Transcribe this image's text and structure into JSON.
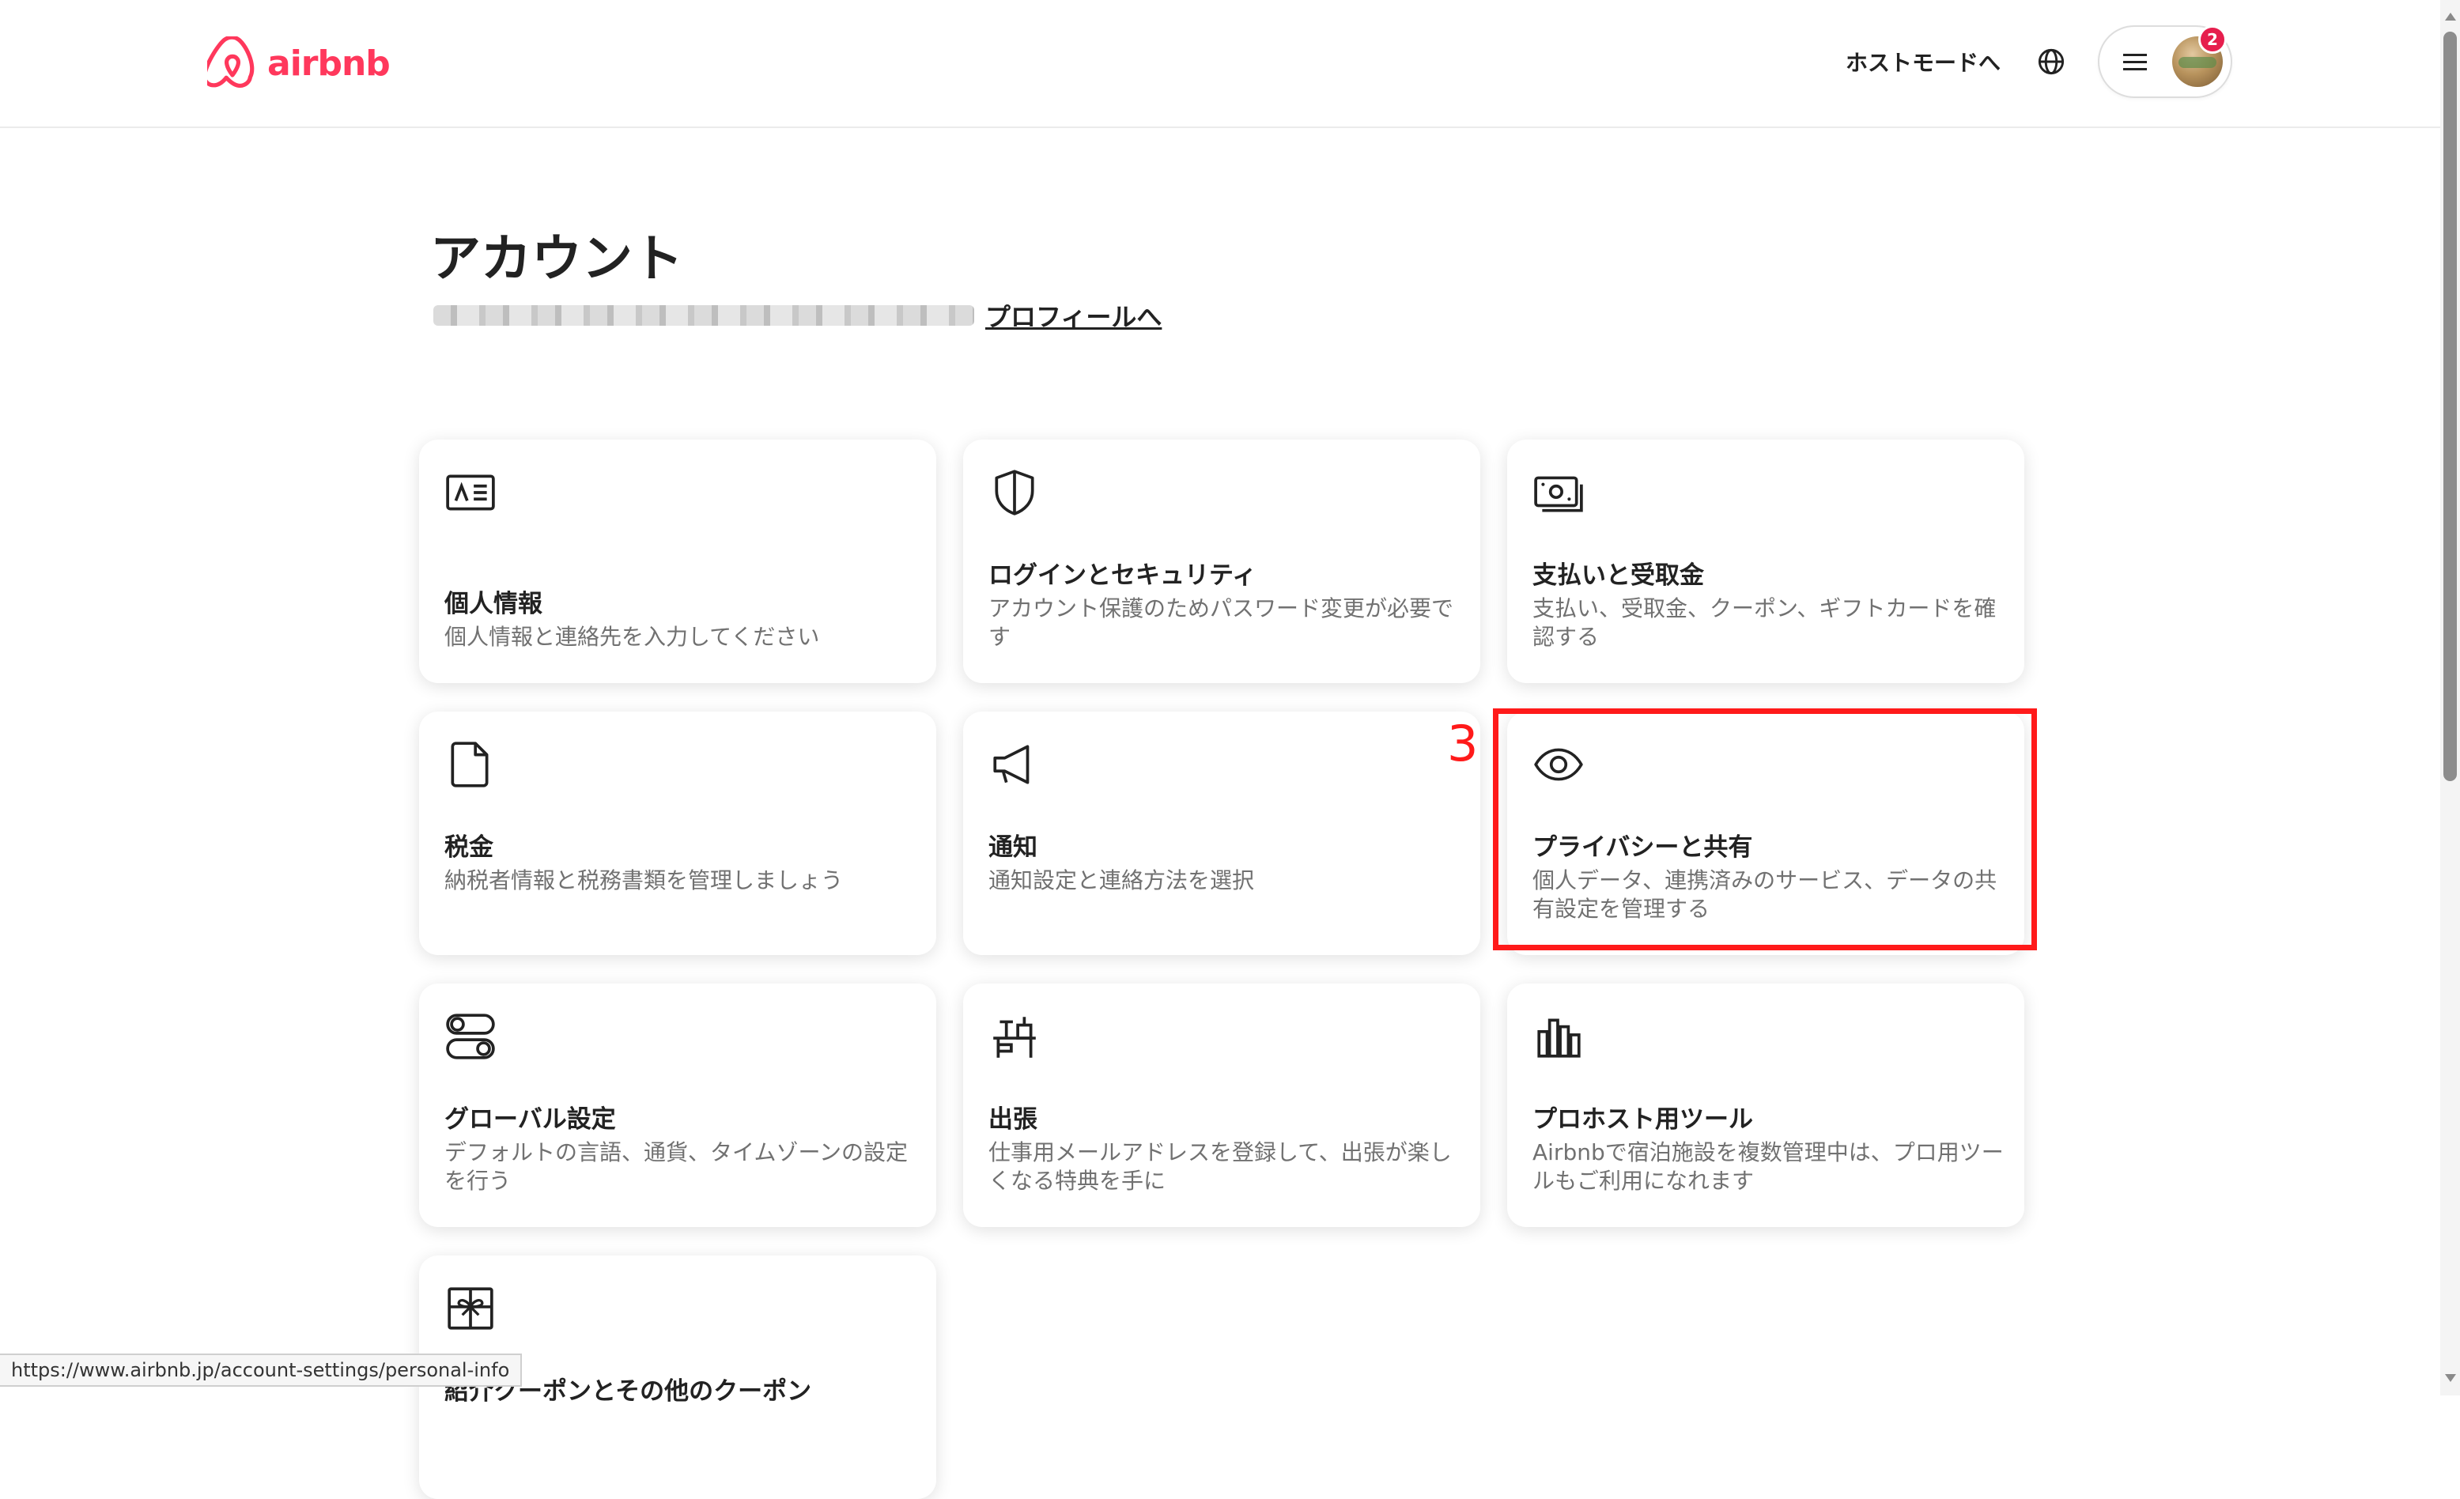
{
  "header": {
    "logo_text": "airbnb",
    "host_link": "ホストモードへ",
    "notification_count": "2",
    "icons": {
      "logo": "airbnb-logo-icon",
      "globe": "globe-icon",
      "menu": "hamburger-menu-icon"
    }
  },
  "main": {
    "title": "アカウント",
    "profile_link": "プロフィールへ"
  },
  "cards": [
    {
      "title": "個人情報",
      "description": "個人情報と連絡先を入力してください",
      "icon": "id-card-icon"
    },
    {
      "title": "ログインとセキュリティ",
      "description": "アカウント保護のためパスワード変更が必要です",
      "icon": "shield-icon"
    },
    {
      "title": "支払いと受取金",
      "description": "支払い、受取金、クーポン、ギフトカードを確認する",
      "icon": "money-icon"
    },
    {
      "title": "税金",
      "description": "納税者情報と税務書類を管理しましょう",
      "icon": "document-icon"
    },
    {
      "title": "通知",
      "description": "通知設定と連絡方法を選択",
      "icon": "megaphone-icon"
    },
    {
      "title": "プライバシーと共有",
      "description": "個人データ、連携済みのサービス、データの共有設定を管理する",
      "icon": "eye-icon"
    },
    {
      "title": "グローバル設定",
      "description": "デフォルトの言語、通貨、タイムゾーンの設定を行う",
      "icon": "toggles-icon"
    },
    {
      "title": "出張",
      "description": "仕事用メールアドレスを登録して、出張が楽しくなる特典を手に",
      "icon": "desk-icon"
    },
    {
      "title": "プロホスト用ツール",
      "description": "Airbnbで宿泊施設を複数管理中は、プロ用ツールもご利用になれます",
      "icon": "bar-chart-icon"
    },
    {
      "title": "紹介クーポンとその他のクーポン",
      "description": "",
      "icon": "gift-icon"
    }
  ],
  "annotation": {
    "step_number": "3",
    "highlight_color": "#ff1a1a"
  },
  "status_bar": {
    "url": "https://www.airbnb.jp/account-settings/personal-info"
  },
  "colors": {
    "brand": "#ff385c",
    "badge": "#e61e4d",
    "text": "#222222",
    "muted": "#717171"
  }
}
